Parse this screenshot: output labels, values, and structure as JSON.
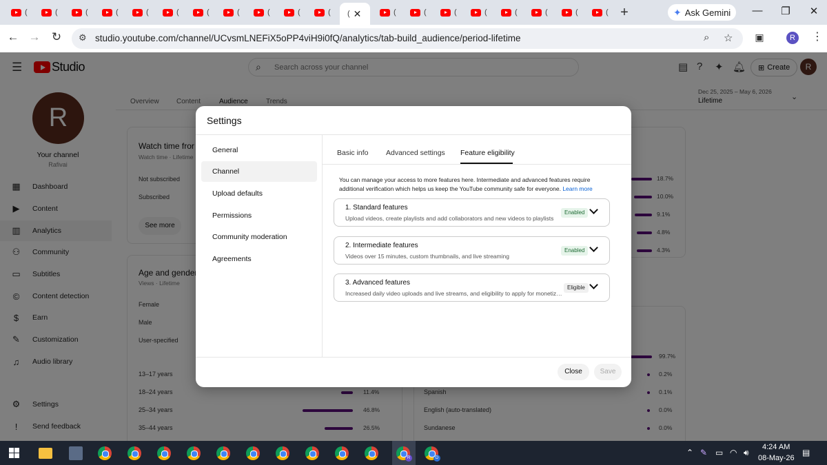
{
  "browser": {
    "tab_paren": "(",
    "new_tab_label": "+",
    "gemini_label": "Ask Gemini",
    "url": "studio.youtube.com/channel/UCvsmLNEFiX5oPP4viH9i0fQ/analytics/tab-build_audience/period-lifetime",
    "profile_initial": "R"
  },
  "studio": {
    "logo_text": "Studio",
    "search_placeholder": "Search across your channel",
    "create_label": "Create",
    "account_initial": "R",
    "channel": {
      "avatar_letter": "R",
      "title": "Your channel",
      "handle": "Rafivai"
    },
    "nav": [
      {
        "label": "Dashboard",
        "icon": "dashboard-icon"
      },
      {
        "label": "Content",
        "icon": "content-icon"
      },
      {
        "label": "Analytics",
        "icon": "analytics-icon"
      },
      {
        "label": "Community",
        "icon": "community-icon"
      },
      {
        "label": "Subtitles",
        "icon": "subtitles-icon"
      },
      {
        "label": "Content detection",
        "icon": "copyright-icon"
      },
      {
        "label": "Earn",
        "icon": "earn-icon"
      },
      {
        "label": "Customization",
        "icon": "customization-icon"
      },
      {
        "label": "Audio library",
        "icon": "audio-library-icon"
      }
    ],
    "nav_bottom": [
      {
        "label": "Settings",
        "icon": "settings-icon"
      },
      {
        "label": "Send feedback",
        "icon": "feedback-icon"
      }
    ],
    "tabs": [
      "Overview",
      "Content",
      "Audience",
      "Trends"
    ],
    "date_range": "Dec 25, 2025 – May 6, 2026",
    "date_period": "Lifetime",
    "watch_card": {
      "title": "Watch time fror",
      "subtitle": "Watch time · Lifetime",
      "rows": [
        "Not subscribed",
        "Subscribed"
      ],
      "see_more": "See more"
    },
    "age_card": {
      "title": "Age and gender",
      "subtitle": "Views · Lifetime",
      "genders": [
        "Female",
        "Male",
        "User-specified"
      ],
      "ages": [
        {
          "label": "13–17 years",
          "pct": ""
        },
        {
          "label": "18–24 years",
          "pct": "11.4%"
        },
        {
          "label": "25–34 years",
          "pct": "46.8%"
        },
        {
          "label": "35–44 years",
          "pct": "26.5%"
        }
      ]
    },
    "right_pcts_top": [
      "18.7%",
      "10.0%",
      "9.1%",
      "4.8%",
      "4.3%"
    ],
    "right_pcts_bottom": [
      "99.7%",
      "0.2%",
      "0.1%",
      "0.0%",
      "0.0%"
    ],
    "languages": [
      "Spanish",
      "English (auto-translated)",
      "Sundanese"
    ]
  },
  "modal": {
    "title": "Settings",
    "nav": [
      "General",
      "Channel",
      "Upload defaults",
      "Permissions",
      "Community moderation",
      "Agreements"
    ],
    "tabs": [
      "Basic info",
      "Advanced settings",
      "Feature eligibility"
    ],
    "intro": "You can manage your access to more features here. Intermediate and advanced features require additional verification which helps us keep the YouTube community safe for everyone.",
    "learn_more": "Learn more",
    "features": [
      {
        "title": "1. Standard features",
        "desc": "Upload videos, create playlists and add collaborators and new videos to playlists",
        "status": "Enabled"
      },
      {
        "title": "2. Intermediate features",
        "desc": "Videos over 15 minutes, custom thumbnails, and live streaming",
        "status": "Enabled"
      },
      {
        "title": "3. Advanced features",
        "desc": "Increased daily video uploads and live streams, and eligibility to apply for monetization",
        "status": "Eligible"
      }
    ],
    "close_label": "Close",
    "save_label": "Save"
  },
  "taskbar": {
    "time": "4:24 AM",
    "date": "08-May-26",
    "profile_badges": [
      "R",
      "D"
    ]
  },
  "colors": {
    "accent_bar": "#5a0f7a",
    "youtube_red": "#ff0000",
    "link_blue": "#065fd4",
    "enabled_badge_bg": "#e6f4ea"
  }
}
